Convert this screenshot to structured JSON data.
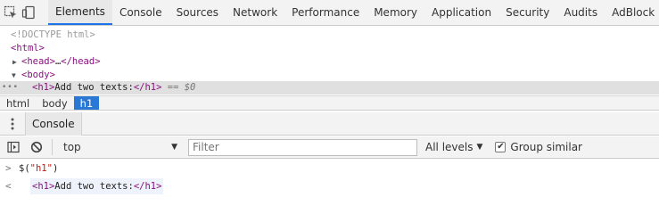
{
  "topbar": {
    "icons": [
      "inspect-cursor-icon",
      "device-toolbar-icon"
    ],
    "tabs": [
      {
        "label": "Elements",
        "active": true
      },
      {
        "label": "Console",
        "active": false
      },
      {
        "label": "Sources",
        "active": false
      },
      {
        "label": "Network",
        "active": false
      },
      {
        "label": "Performance",
        "active": false
      },
      {
        "label": "Memory",
        "active": false
      },
      {
        "label": "Application",
        "active": false
      },
      {
        "label": "Security",
        "active": false
      },
      {
        "label": "Audits",
        "active": false
      },
      {
        "label": "AdBlock",
        "active": false
      }
    ]
  },
  "dom": {
    "doctype": "<!DOCTYPE html>",
    "html_open": "<html>",
    "head_open": "<head>",
    "head_ellipsis": "…",
    "head_close": "</head>",
    "body_open": "<body>",
    "h1_open": "<h1>",
    "h1_text": "Add two texts:",
    "h1_close": "</h1>",
    "selected_marker": "== $0",
    "dots": "•••"
  },
  "breadcrumb": [
    {
      "label": "html",
      "active": false
    },
    {
      "label": "body",
      "active": false
    },
    {
      "label": "h1",
      "active": true
    }
  ],
  "drawer": {
    "tab_label": "Console"
  },
  "console_toolbar": {
    "context": "top",
    "filter_placeholder": "Filter",
    "levels": "All levels",
    "group_similar_label": "Group similar",
    "group_similar_checked": true
  },
  "console_output": {
    "input_prompt": ">",
    "input_fn": "$(",
    "input_arg": "\"h1\"",
    "input_close": ")",
    "result_prompt": "<",
    "result_open": "<h1>",
    "result_text": "Add two texts:",
    "result_close": "</h1>"
  },
  "colors": {
    "tag": "#881280",
    "string": "#c41a16",
    "active_crumb": "#2a78d6",
    "tab_underline": "#1a73e8"
  }
}
